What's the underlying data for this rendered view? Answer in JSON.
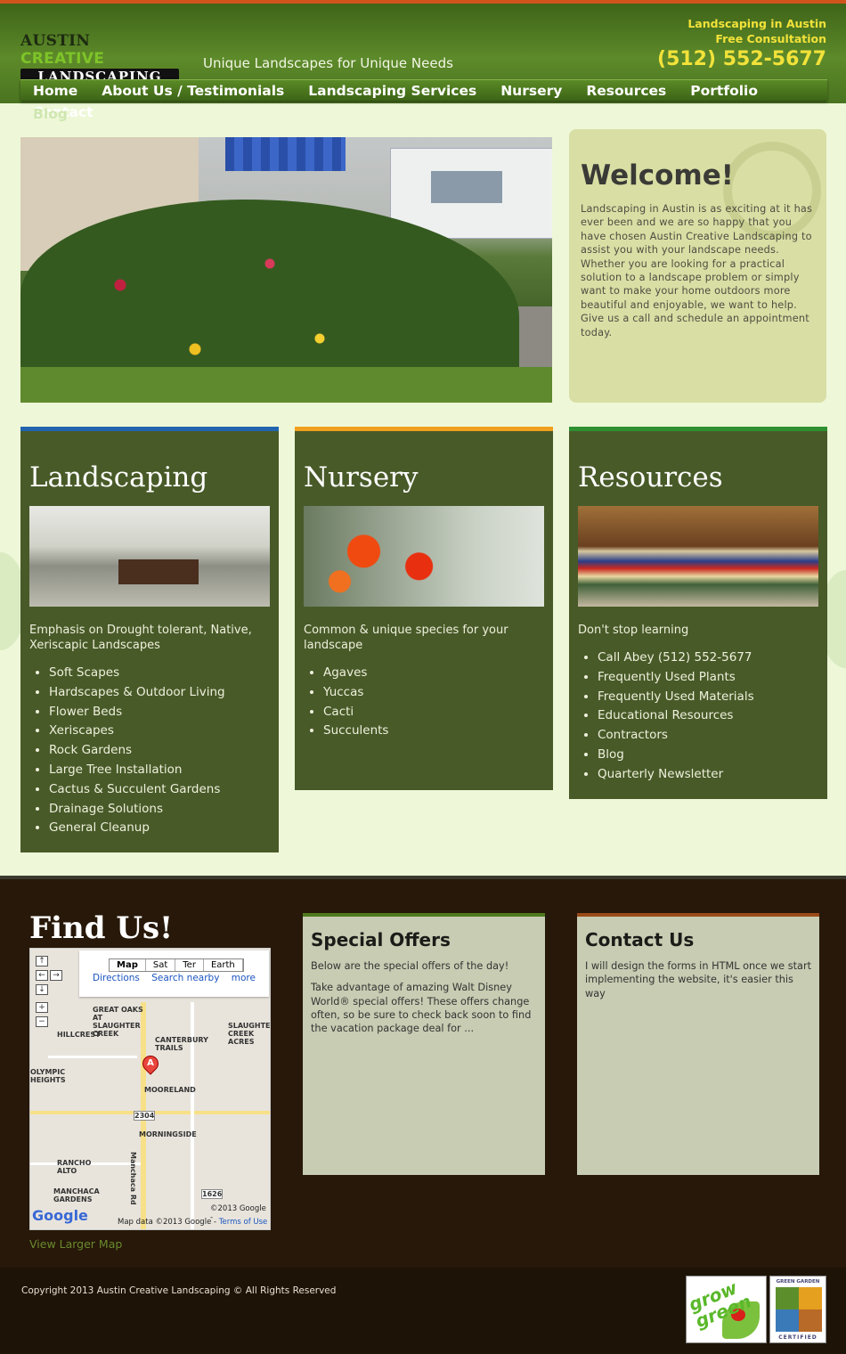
{
  "header": {
    "logo_top_1": "AUSTIN",
    "logo_top_2": "CREATIVE",
    "logo_bottom": "LANDSCAPING",
    "tagline": "Unique Landscapes for Unique Needs",
    "right_line1": "Landscaping in Austin",
    "right_line2": "Free Consultation",
    "phone": "(512) 552-5677"
  },
  "nav": {
    "items": [
      "Home",
      "About Us / Testimonials",
      "Landscaping Services",
      "Nursery",
      "Resources",
      "Portfolio",
      "Contact",
      "Blog"
    ]
  },
  "welcome": {
    "title": "Welcome!",
    "body": "Landscaping in Austin is as exciting at it has ever been and we are so happy that you have chosen Austin Creative Landscaping to assist you with your landscape needs. Whether you are looking for a practical solution to a landscape problem or simply want to make your home outdoors more beautiful and enjoyable, we want to help. Give us a call and schedule an appointment today."
  },
  "boxes": [
    {
      "title": "Landscaping",
      "desc": "Emphasis on Drought tolerant, Native, Xeriscapic Landscapes",
      "items": [
        "Soft Scapes",
        "Hardscapes & Outdoor Living",
        "Flower Beds",
        "Xeriscapes",
        "Rock Gardens",
        "Large Tree Installation",
        "Cactus & Succulent Gardens",
        "Drainage Solutions",
        "General Cleanup"
      ]
    },
    {
      "title": "Nursery",
      "desc": "Common & unique species for your landscape",
      "items": [
        "Agaves",
        "Yuccas",
        "Cacti",
        "Succulents"
      ]
    },
    {
      "title": "Resources",
      "desc": "Don't stop learning",
      "items": [
        "Call Abey (512) 552-5677",
        "Frequently Used Plants",
        "Frequently Used Materials",
        "Educational Resources",
        "Contractors",
        "Blog",
        "Quarterly Newsletter"
      ]
    }
  ],
  "findus": {
    "title": "Find Us!",
    "map_tabs": [
      "Map",
      "Sat",
      "Ter",
      "Earth"
    ],
    "map_links": [
      "Directions",
      "Search nearby",
      "more"
    ],
    "map_labels": [
      "GREAT OAKS AT SLAUGHTER CREEK",
      "HILLCREST",
      "CANTERBURY TRAILS",
      "SLAUGHTER CREEK ACRES",
      "OLYMPIC HEIGHTS",
      "MOORELAND",
      "2304",
      "MORNINGSIDE",
      "RANCHO ALTO",
      "MANCHACA GARDENS",
      "Manchaca Rd",
      "1626"
    ],
    "map_pin": "A",
    "map_logo": "Google",
    "map_copyright": "©2013 Google -",
    "map_data": "Map data ©2013 Google -",
    "map_terms": "Terms of Use",
    "larger_map": "View Larger Map"
  },
  "offers": {
    "title": "Special Offers",
    "p1": "Below are the special offers of the day!",
    "p2": "Take advantage of amazing Walt Disney World® special offers! These offers change often, so be sure to check back soon to find the vacation package deal for ..."
  },
  "contact": {
    "title": "Contact Us",
    "p1": "I will design the forms in HTML once we start implementing the website, it's easier this way"
  },
  "footer": {
    "copyright": "Copyright 2013 Austin Creative Landscaping © All Rights Reserved",
    "badge1": "grow green",
    "badge2_top": "GREEN GARDEN",
    "badge2_bottom": "CERTIFIED"
  }
}
